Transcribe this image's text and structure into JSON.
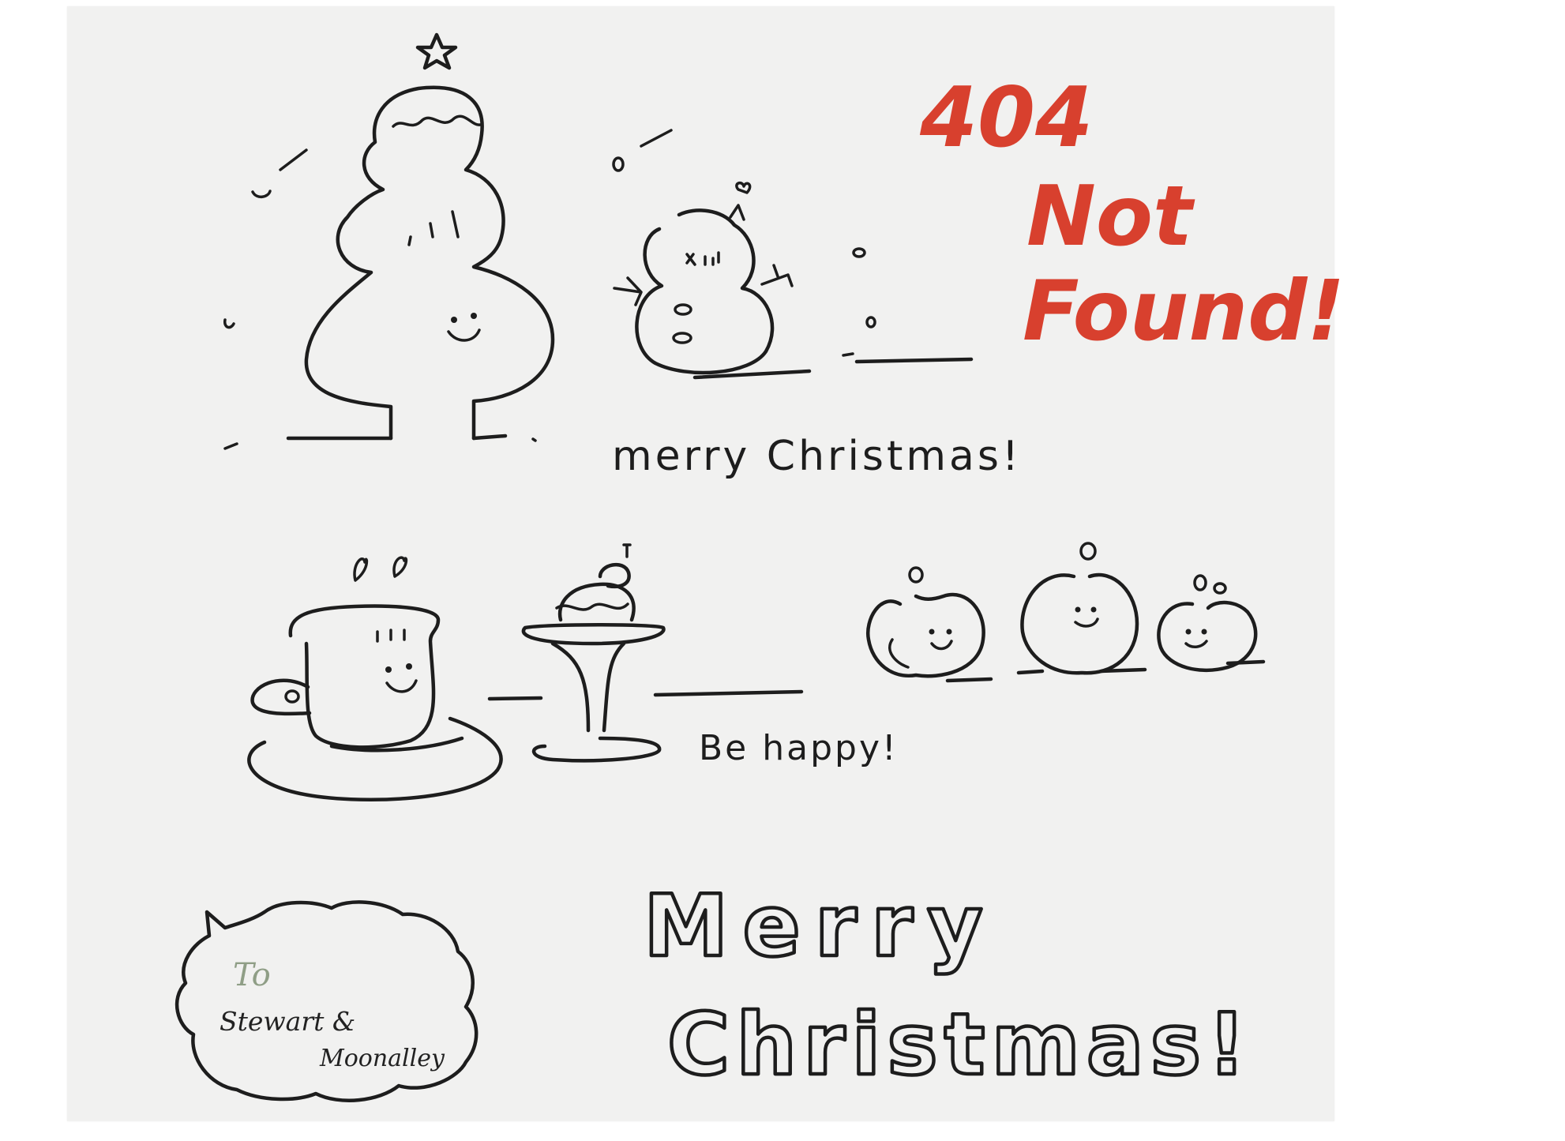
{
  "error": {
    "line1": "404",
    "line2": "Not",
    "line3": "Found!"
  },
  "greetings": {
    "merry_small": "merry Christmas!",
    "be_happy": "Be happy!",
    "merry_big": "Merry",
    "christmas_big": "Christmas!"
  },
  "bubble": {
    "to": "To",
    "name1": "Stewart &",
    "name2": "Moonalley"
  },
  "colors": {
    "paper": "#f1f1f0",
    "ink": "#1d1d1d",
    "accent": "#d8402e",
    "to_ink": "#8f9e86"
  },
  "illustrations": [
    "christmas-tree",
    "snowman",
    "coffee-cup",
    "cake-stand",
    "apples"
  ]
}
